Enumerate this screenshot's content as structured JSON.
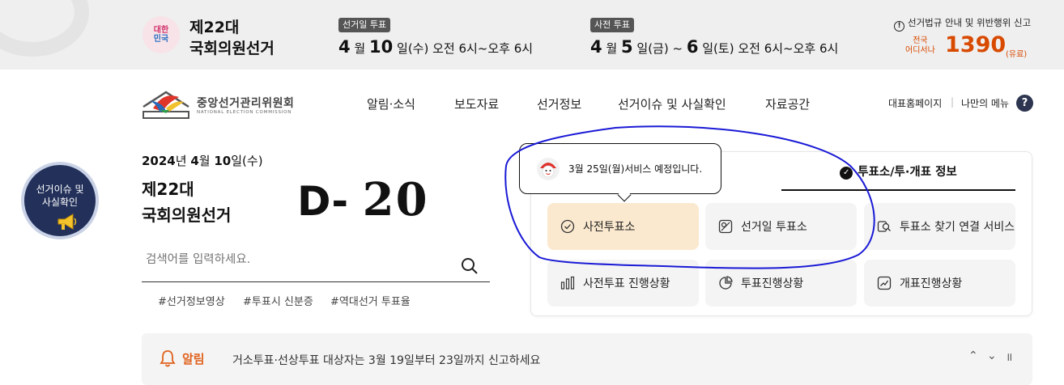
{
  "topbar": {
    "mascot_line1": "대한",
    "mascot_line2": "민국",
    "title_line1": "제22대",
    "title_line2": "국회의원선거",
    "election_day": {
      "tag": "선거일 투표",
      "month": "4",
      "month_unit": "월",
      "day": "10",
      "rest": "일(수) 오전 6시~오후 6시"
    },
    "early_vote": {
      "tag": "사전 투표",
      "month": "4",
      "month_unit": "월",
      "day1": "5",
      "mid": "일(금) ~",
      "day2": "6",
      "rest": "일(토) 오전 6시~오후 6시"
    },
    "report_text": "선거법규 안내 및 위반행위 신고",
    "report_icon": "info-circle-icon",
    "hotline_label1": "전국",
    "hotline_label2": "어디서나",
    "hotline_number": "1390",
    "hotline_fee": "(유료)",
    "accent_color": "#d84a00"
  },
  "header": {
    "logo_text": "중앙선거관리위원회",
    "logo_sub": "NATIONAL ELECTION COMMISSION",
    "nav": [
      "알림·소식",
      "보도자료",
      "선거정보",
      "선거이슈 및 사실확인",
      "자료공간"
    ],
    "util_home": "대표홈페이지",
    "util_menu": "나만의 메뉴",
    "help_label": "?"
  },
  "floating_badge": {
    "line1": "선거이슈 및",
    "line2": "사실확인"
  },
  "hero": {
    "date_year": "2024",
    "date_year_unit": "년",
    "date_month": "4",
    "date_month_unit": "월",
    "date_day": "10",
    "date_day_unit": "일(수)",
    "title_line1": "제22대",
    "title_line2": "국회의원선거",
    "dday_prefix": "D-",
    "dday_value": "20",
    "search_placeholder": "검색어를 입력하세요.",
    "hashtags": [
      "#선거정보영상",
      "#투표시 신분증",
      "#역대선거 투표율"
    ]
  },
  "panel": {
    "tab_label": "투표소/투·개표 정보",
    "tooltip_text": "3월 25일(월)서비스 예정입니다.",
    "tiles": [
      {
        "label": "사전투표소",
        "icon": "check-circle-icon",
        "active": true
      },
      {
        "label": "선거일 투표소",
        "icon": "ballot-icon",
        "active": false
      },
      {
        "label": "투표소 찾기 연결 서비스",
        "icon": "link-search-icon",
        "active": false
      },
      {
        "label": "사전투표 진행상황",
        "icon": "bar-chart-icon",
        "active": false
      },
      {
        "label": "투표진행상황",
        "icon": "pie-chart-icon",
        "active": false
      },
      {
        "label": "개표진행상황",
        "icon": "line-chart-icon",
        "active": false
      }
    ]
  },
  "notice": {
    "label": "알림",
    "message": "거소투표·선상투표 대상자는 3월 19일부터 23일까지 신고하세요",
    "prev": "⌃",
    "next": "⌄",
    "pause": "॥"
  }
}
